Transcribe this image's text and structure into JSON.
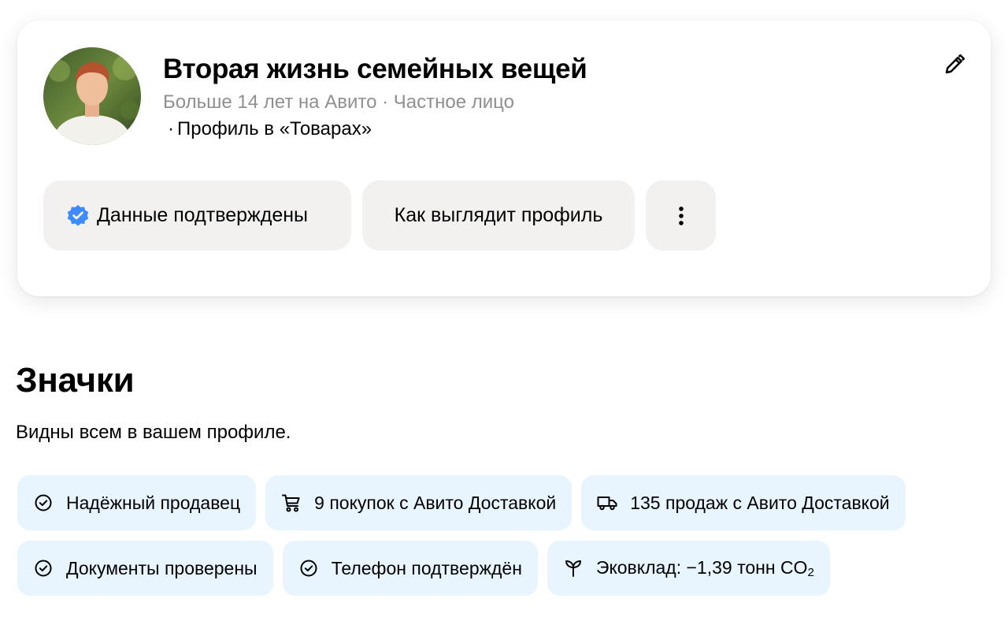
{
  "profile": {
    "name": "Вторая жизнь семейных вещей",
    "meta": "Больше 14 лет на Авито · Частное лицо",
    "link_prefix": "·",
    "link": "Профиль в «Товарах»"
  },
  "actions": {
    "verified_label": "Данные подтверждены",
    "preview_label": "Как выглядит профиль"
  },
  "badges": {
    "title": "Значки",
    "subtitle": "Видны всем в вашем профиле.",
    "items": [
      {
        "label": "Надёжный продавец",
        "icon": "check-circle-icon"
      },
      {
        "label": "9 покупок с Авито Доставкой",
        "icon": "cart-icon"
      },
      {
        "label": "135 продаж с Авито Доставкой",
        "icon": "truck-icon"
      },
      {
        "label": "Документы проверены",
        "icon": "check-circle-icon"
      },
      {
        "label": "Телефон подтверждён",
        "icon": "check-circle-icon"
      },
      {
        "label": "Эковклад: −1,39 тонн CO",
        "icon": "sprout-icon"
      }
    ],
    "eco_sub": "2"
  },
  "colors": {
    "accent_blue": "#3d8bff",
    "badge_bg": "#e9f5fe",
    "button_bg": "#f2f1f0",
    "muted_text": "#8f8f8f"
  }
}
